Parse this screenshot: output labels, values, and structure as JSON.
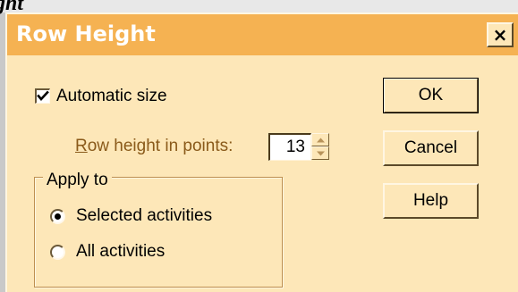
{
  "background": {
    "partial_text": "ght"
  },
  "dialog": {
    "title": "Row Height",
    "close_label": "×",
    "title_color": "#f5b252",
    "body_color": "#fde7b8",
    "automatic_size": {
      "label": "Automatic size",
      "checked": true
    },
    "row_height": {
      "label_accel": "R",
      "label_rest": "ow height in points:",
      "value": "13"
    },
    "apply_to": {
      "label": "Apply to",
      "options": [
        {
          "label": "Selected activities",
          "selected": true
        },
        {
          "label": "All activities",
          "selected": false
        }
      ]
    },
    "buttons": {
      "ok": "OK",
      "cancel": "Cancel",
      "help": "Help"
    }
  }
}
